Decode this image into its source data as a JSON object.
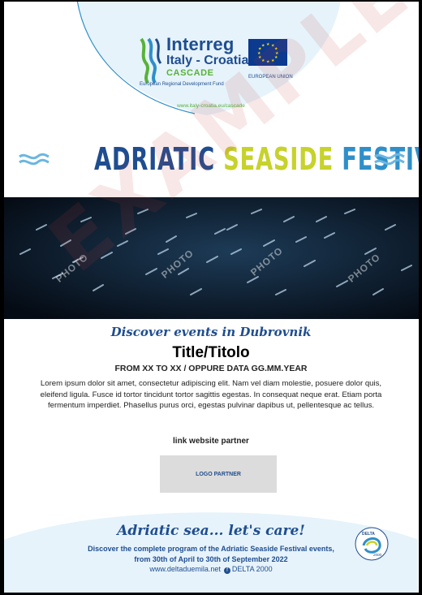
{
  "header": {
    "program_brand": "Interreg",
    "program_name": "Italy - Croatia",
    "project_name": "CASCADE",
    "fund": "European Regional Development Fund",
    "eu_label": "EUROPEAN UNION",
    "website": "www.italy-croatia.eu/cascade"
  },
  "festival": {
    "title_part1": "ADRIATIC ",
    "title_part2": "SEASIDE ",
    "title_part3": "FESTIVAL"
  },
  "photo": {
    "labels": [
      "PHOTO",
      "PHOTO",
      "PHOTO",
      "PHOTO"
    ]
  },
  "watermark": "EXAMPLE",
  "event": {
    "subtitle": "Discover events in Dubrovnik",
    "title": "Title/Titolo",
    "dates": "FROM XX TO XX / OPPURE DATA GG.MM.YEAR",
    "description": "Lorem ipsum dolor sit amet, consectetur adipiscing elit. Nam vel diam molestie, posuere dolor quis, eleifend ligula. Fusce id tortor tincidunt tortor sagittis egestas. In consequat neque erat. Etiam porta fermentum imperdiet. Phasellus purus orci, egestas pulvinar dapibus ut, pellentesque ac tellus.",
    "partner_link": "link website partner",
    "partner_logo": "LOGO PARTNER"
  },
  "footer": {
    "slogan": "Adriatic sea... let's care!",
    "program_text_1": "Discover the complete program of the Adriatic Seaside Festival events,",
    "program_text_2": "from 30th of April to 30th of September 2022",
    "site": "www.deltaduemila.net",
    "facebook": "DELTA 2000",
    "delta_logo_text": "DELTA",
    "delta_logo_year": "2000"
  },
  "colors": {
    "brand_blue": "#1f4d8f",
    "lime": "#c7d22c",
    "light_blue": "#2f8fc9",
    "green": "#58b23a"
  }
}
